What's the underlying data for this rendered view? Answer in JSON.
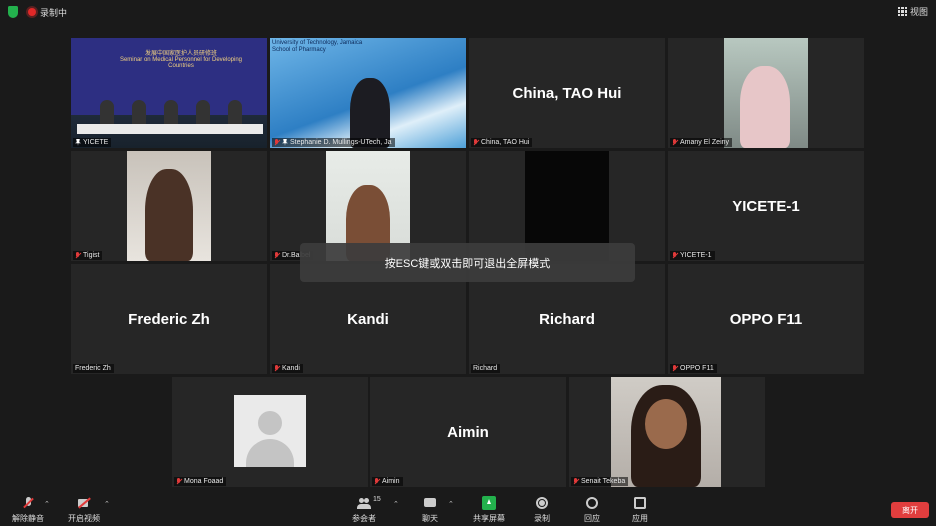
{
  "top_bar": {
    "recording_label": "录制中",
    "view_label": "视图"
  },
  "tiles": [
    {
      "id": "yicete",
      "label": "YICETE",
      "display_name": "",
      "muted": false,
      "pinned": true,
      "active": true
    },
    {
      "id": "stephanie",
      "label": "Stephanie D. Mullings-UTech, Ja",
      "display_name": "",
      "muted": true,
      "pinned": true
    },
    {
      "id": "tao-hui",
      "label": "China, TAO Hui",
      "display_name": "China, TAO Hui",
      "muted": true
    },
    {
      "id": "amany",
      "label": "Amany El Zeiny",
      "display_name": "",
      "muted": true
    },
    {
      "id": "tigist",
      "label": "Tigist",
      "display_name": "",
      "muted": true
    },
    {
      "id": "dr-balbel",
      "label": "Dr.Balbel",
      "display_name": "",
      "muted": true
    },
    {
      "id": "hidden",
      "label": "",
      "display_name": "",
      "muted": true
    },
    {
      "id": "yicete-1",
      "label": "YICETE-1",
      "display_name": "YICETE-1",
      "muted": true
    },
    {
      "id": "frederic",
      "label": "Frederic Zh",
      "display_name": "Frederic Zh",
      "muted": false
    },
    {
      "id": "kandi",
      "label": "Kandi",
      "display_name": "Kandi",
      "muted": true
    },
    {
      "id": "richard",
      "label": "Richard",
      "display_name": "Richard",
      "muted": false
    },
    {
      "id": "oppo",
      "label": "OPPO F11",
      "display_name": "OPPO F11",
      "muted": true
    },
    {
      "id": "mona",
      "label": "Mona Foaad",
      "display_name": "",
      "muted": true
    },
    {
      "id": "aimin",
      "label": "Aimin",
      "display_name": "Aimin",
      "muted": true
    },
    {
      "id": "senait",
      "label": "Senait Tekeba",
      "display_name": "",
      "muted": true
    }
  ],
  "conference_banner": {
    "title": "发展中国家医护人员研修班",
    "subtitle": "Seminar on Medical Personnel for Developing Countries"
  },
  "university_banner": {
    "line1": "University of Technology, Jamaica",
    "line2": "School of Pharmacy"
  },
  "toast": "按ESC键或双击即可退出全屏模式",
  "toolbar": {
    "unmute": "解除静音",
    "start_video": "开启视频",
    "participants": "参会者",
    "participant_count": "15",
    "chat": "聊天",
    "share_screen": "共享屏幕",
    "record": "录制",
    "reactions": "回应",
    "apps": "应用",
    "leave": "离开"
  },
  "colors": {
    "active_outline": "#c8e23a",
    "leave": "#e03e3e",
    "share": "#23b14d",
    "muted_mic": "#e03a3a"
  }
}
